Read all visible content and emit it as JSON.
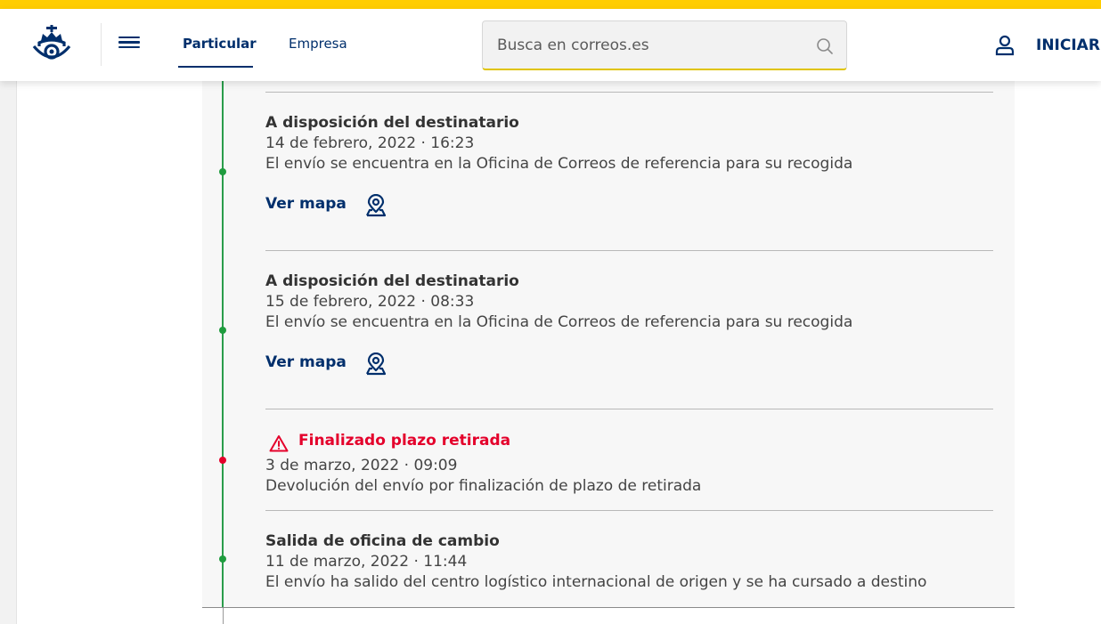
{
  "header": {
    "brand_color": "#ffcd00",
    "nav_tabs": [
      {
        "label": "Particular",
        "active": true
      },
      {
        "label": "Empresa",
        "active": false
      }
    ],
    "search_placeholder": "Busca en correos.es",
    "login_label": "INICIAR"
  },
  "tracking": {
    "events": [
      {
        "title": "A disposición del destinatario",
        "datetime": "14 de febrero, 2022 · 16:23",
        "description": "El envío se encuentra en la Oficina de Correos de referencia para su recogida",
        "map_label": "Ver mapa",
        "status": "ok"
      },
      {
        "title": "A disposición del destinatario",
        "datetime": "15 de febrero, 2022 · 08:33",
        "description": "El envío se encuentra en la Oficina de Correos de referencia para su recogida",
        "map_label": "Ver mapa",
        "status": "ok"
      },
      {
        "title": "Finalizado plazo retirada",
        "datetime": "3 de marzo, 2022 · 09:09",
        "description": "Devolución del envío por finalización de plazo de retirada",
        "status": "warning"
      },
      {
        "title": "Salida de oficina de cambio",
        "datetime": "11 de marzo, 2022 · 11:44",
        "description": "El envío ha salido del centro logístico internacional de origen y se ha cursado a destino",
        "status": "ok"
      }
    ],
    "colors": {
      "ok": "#1f9c3e",
      "warning": "#e4002b",
      "link": "#002f6c"
    }
  }
}
